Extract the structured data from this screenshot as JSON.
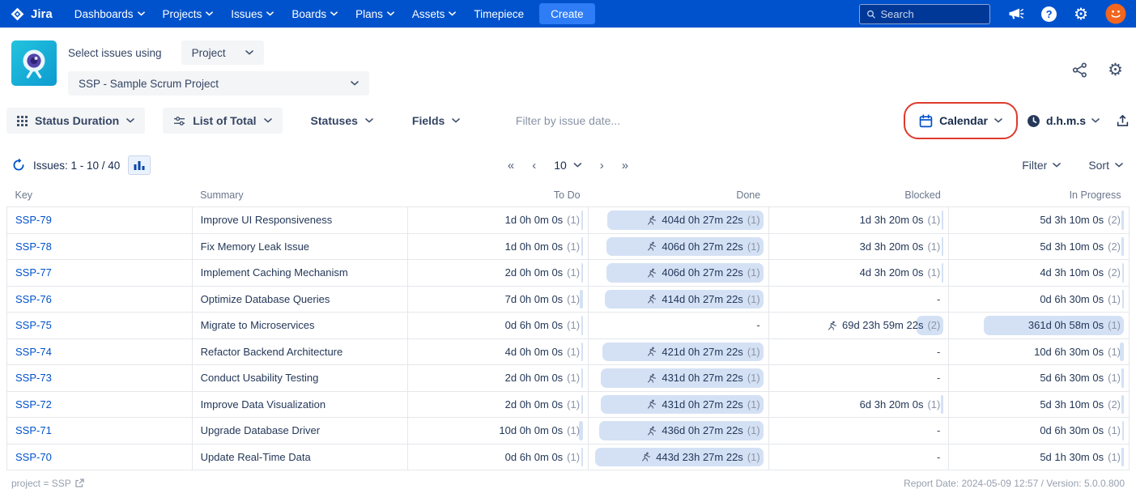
{
  "nav": {
    "brand": "Jira",
    "menu": [
      {
        "label": "Dashboards",
        "chevron": true
      },
      {
        "label": "Projects",
        "chevron": true
      },
      {
        "label": "Issues",
        "chevron": true
      },
      {
        "label": "Boards",
        "chevron": true
      },
      {
        "label": "Plans",
        "chevron": true
      },
      {
        "label": "Assets",
        "chevron": true
      },
      {
        "label": "Timepiece",
        "chevron": false
      }
    ],
    "create_label": "Create",
    "search_placeholder": "Search"
  },
  "icons": {
    "gear": "⚙",
    "help": "?"
  },
  "header": {
    "select_label": "Select issues using",
    "scope_value": "Project",
    "project_value": "SSP - Sample Scrum Project"
  },
  "toolbar": {
    "report_type_label": "Status Duration",
    "list_mode_label": "List of Total",
    "statuses_label": "Statuses",
    "fields_label": "Fields",
    "date_filter_placeholder": "Filter by issue date...",
    "calendar_label": "Calendar",
    "time_format_label": "d.h.m.s"
  },
  "pagination": {
    "issues_label": "Issues: 1 - 10 / 40",
    "first": "«",
    "prev": "‹",
    "page_size": "10",
    "next": "›",
    "last": "»",
    "filter_label": "Filter",
    "sort_label": "Sort"
  },
  "table": {
    "columns": [
      {
        "label": "Key",
        "align": "left"
      },
      {
        "label": "Summary",
        "align": "left"
      },
      {
        "label": "To Do",
        "align": "right"
      },
      {
        "label": "Done",
        "align": "right"
      },
      {
        "label": "Blocked",
        "align": "right"
      },
      {
        "label": "In Progress",
        "align": "right"
      }
    ],
    "rows": [
      {
        "key": "SSP-79",
        "summary": "Improve UI Responsiveness",
        "cells": [
          {
            "text": "1d 0h 0m 0s",
            "count": "(1)",
            "bar": 0.004
          },
          {
            "text": "404d 0h 27m 22s",
            "count": "(1)",
            "bar": 0.87,
            "runner": true
          },
          {
            "text": "1d 3h 20m 0s",
            "count": "(1)",
            "bar": 0.004
          },
          {
            "text": "5d 3h 10m 0s",
            "count": "(2)",
            "bar": 0.013
          }
        ]
      },
      {
        "key": "SSP-78",
        "summary": "Fix Memory Leak Issue",
        "cells": [
          {
            "text": "1d 0h 0m 0s",
            "count": "(1)",
            "bar": 0.004
          },
          {
            "text": "406d 0h 27m 22s",
            "count": "(1)",
            "bar": 0.873,
            "runner": true
          },
          {
            "text": "3d 3h 20m 0s",
            "count": "(1)",
            "bar": 0.008
          },
          {
            "text": "5d 3h 10m 0s",
            "count": "(2)",
            "bar": 0.013
          }
        ]
      },
      {
        "key": "SSP-77",
        "summary": "Implement Caching Mechanism",
        "cells": [
          {
            "text": "2d 0h 0m 0s",
            "count": "(1)",
            "bar": 0.006
          },
          {
            "text": "406d 0h 27m 22s",
            "count": "(1)",
            "bar": 0.873,
            "runner": true
          },
          {
            "text": "4d 3h 20m 0s",
            "count": "(1)",
            "bar": 0.01
          },
          {
            "text": "4d 3h 10m 0s",
            "count": "(2)",
            "bar": 0.01
          }
        ]
      },
      {
        "key": "SSP-76",
        "summary": "Optimize Database Queries",
        "cells": [
          {
            "text": "7d 0h 0m 0s",
            "count": "(1)",
            "bar": 0.017
          },
          {
            "text": "414d 0h 27m 22s",
            "count": "(1)",
            "bar": 0.885,
            "runner": true
          },
          {
            "text": "-"
          },
          {
            "text": "0d 6h 30m 0s",
            "count": "(1)",
            "bar": 0.002
          }
        ]
      },
      {
        "key": "SSP-75",
        "summary": "Migrate to Microservices",
        "cells": [
          {
            "text": "0d 6h 0m 0s",
            "count": "(1)",
            "bar": 0.002
          },
          {
            "text": "-"
          },
          {
            "text": "69d 23h 59m 22s",
            "count": "(2)",
            "bar": 0.152,
            "runner": true
          },
          {
            "text": "361d 0h 58m 0s",
            "count": "(1)",
            "bar": 0.78
          }
        ]
      },
      {
        "key": "SSP-74",
        "summary": "Refactor Backend Architecture",
        "cells": [
          {
            "text": "4d 0h 0m 0s",
            "count": "(1)",
            "bar": 0.01
          },
          {
            "text": "421d 0h 27m 22s",
            "count": "(1)",
            "bar": 0.895,
            "runner": true
          },
          {
            "text": "-"
          },
          {
            "text": "10d 6h 30m 0s",
            "count": "(1)",
            "bar": 0.024
          }
        ]
      },
      {
        "key": "SSP-73",
        "summary": "Conduct Usability Testing",
        "cells": [
          {
            "text": "2d 0h 0m 0s",
            "count": "(1)",
            "bar": 0.006
          },
          {
            "text": "431d 0h 27m 22s",
            "count": "(1)",
            "bar": 0.905,
            "runner": true
          },
          {
            "text": "-"
          },
          {
            "text": "5d 6h 30m 0s",
            "count": "(1)",
            "bar": 0.013
          }
        ]
      },
      {
        "key": "SSP-72",
        "summary": "Improve Data Visualization",
        "cells": [
          {
            "text": "2d 0h 0m 0s",
            "count": "(1)",
            "bar": 0.006
          },
          {
            "text": "431d 0h 27m 22s",
            "count": "(1)",
            "bar": 0.905,
            "runner": true
          },
          {
            "text": "6d 3h 20m 0s",
            "count": "(1)",
            "bar": 0.015
          },
          {
            "text": "5d 3h 10m 0s",
            "count": "(2)",
            "bar": 0.013
          }
        ]
      },
      {
        "key": "SSP-71",
        "summary": "Upgrade Database Driver",
        "cells": [
          {
            "text": "10d 0h 0m 0s",
            "count": "(1)",
            "bar": 0.024
          },
          {
            "text": "436d 0h 27m 22s",
            "count": "(1)",
            "bar": 0.915,
            "runner": true
          },
          {
            "text": "-"
          },
          {
            "text": "0d 6h 30m 0s",
            "count": "(1)",
            "bar": 0.002
          }
        ]
      },
      {
        "key": "SSP-70",
        "summary": "Update Real-Time Data",
        "cells": [
          {
            "text": "0d 6h 0m 0s",
            "count": "(1)",
            "bar": 0.002
          },
          {
            "text": "443d 23h 27m 22s",
            "count": "(1)",
            "bar": 0.935,
            "runner": true
          },
          {
            "text": "-"
          },
          {
            "text": "5d 1h 30m 0s",
            "count": "(1)",
            "bar": 0.013
          }
        ]
      }
    ]
  },
  "footer": {
    "query_label": "project = SSP",
    "report_info": "Report Date: 2024-05-09 12:57 / Version: 5.0.0.800"
  },
  "colors": {
    "nav_blue": "#0052CC",
    "accent": "#0052CC",
    "chip": "#D4E1F5",
    "annotation_red": "#DF3A2C"
  }
}
